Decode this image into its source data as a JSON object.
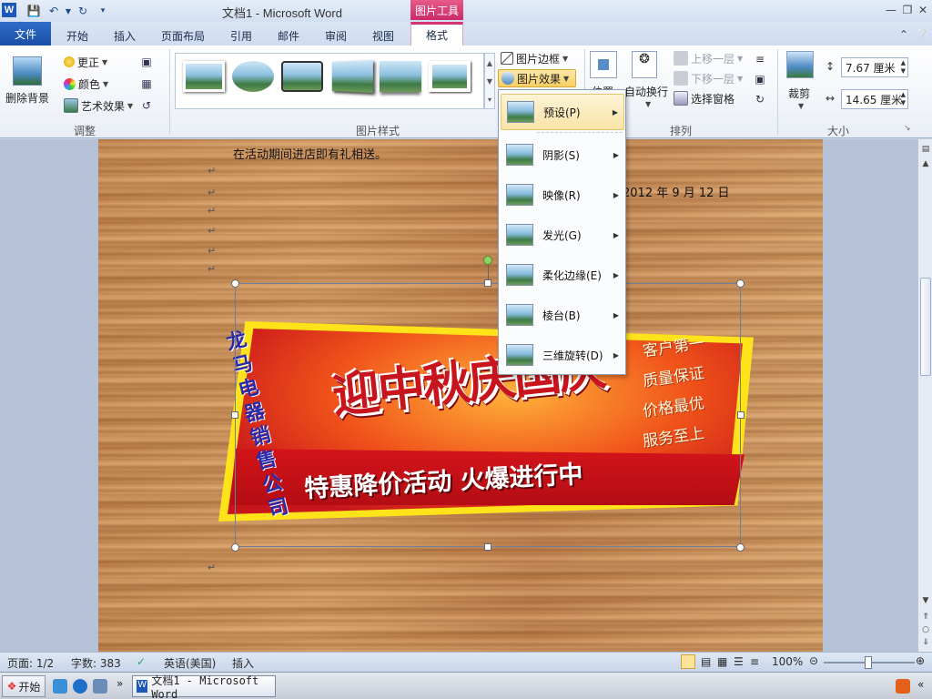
{
  "titlebar": {
    "title": "文档1  -  Microsoft Word",
    "context_tab_group": "图片工具",
    "app_icon_letter": "W"
  },
  "tabs": {
    "file": "文件",
    "home": "开始",
    "insert": "插入",
    "page_layout": "页面布局",
    "references": "引用",
    "mailings": "邮件",
    "review": "审阅",
    "view": "视图",
    "format": "格式"
  },
  "ribbon": {
    "adjust": {
      "remove_background": "删除背景",
      "corrections": "更正",
      "color": "颜色",
      "artistic_effects": "艺术效果",
      "group_label": "调整"
    },
    "picture_styles": {
      "picture_border": "图片边框",
      "picture_effects": "图片效果",
      "group_label": "图片样式"
    },
    "arrange": {
      "position": "位置",
      "wrap_text": "自动换行",
      "bring_forward": "上移一层",
      "send_backward": "下移一层",
      "selection_pane": "选择窗格",
      "group_label": "排列"
    },
    "size": {
      "crop": "裁剪",
      "height": "7.67 厘米",
      "width": "14.65 厘米",
      "group_label": "大小"
    }
  },
  "effects_menu": {
    "items": [
      {
        "label": "预设(P)",
        "icon": "preset-icon"
      },
      {
        "label": "阴影(S)",
        "icon": "shadow-icon"
      },
      {
        "label": "映像(R)",
        "icon": "reflection-icon"
      },
      {
        "label": "发光(G)",
        "icon": "glow-icon"
      },
      {
        "label": "柔化边缘(E)",
        "icon": "soft-edges-icon"
      },
      {
        "label": "棱台(B)",
        "icon": "bevel-icon"
      },
      {
        "label": "三维旋转(D)",
        "icon": "3d-rotation-icon"
      }
    ]
  },
  "document": {
    "line1": "在活动期间进店即有礼相送。",
    "date": "2012 年 9 月 12 日",
    "banner": {
      "vertical_company": "龙马电器销售公司",
      "main_title": "迎中秋庆国庆",
      "right_lines": [
        "客户第一",
        "质量保证",
        "价格最优",
        "服务至上"
      ],
      "slogan": "特惠降价活动 火爆进行中"
    }
  },
  "statusbar": {
    "page": "页面: 1/2",
    "words": "字数: 383",
    "language": "英语(美国)",
    "mode": "插入",
    "zoom": "100%"
  },
  "taskbar": {
    "start": "开始",
    "word_task": "文档1 - Microsoft Word"
  },
  "colors": {
    "file_tab": "#2f6cc8",
    "context_tab": "#d2356f",
    "menu_highlight": "#f8e4a8"
  }
}
